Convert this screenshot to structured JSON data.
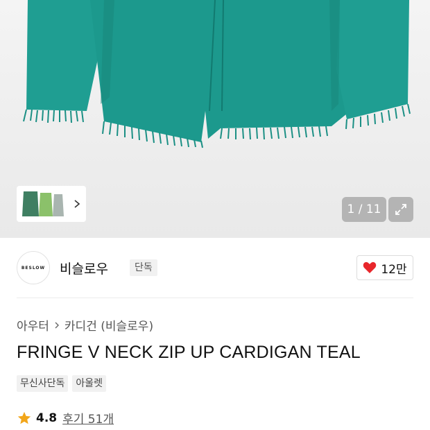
{
  "gallery": {
    "counter_text": "1 / 11",
    "colors": {
      "teal": "#1f9e92",
      "teal_dark": "#17857a"
    },
    "thumbnails": [
      "green-cardigan-icon",
      "lime-cardigan-icon",
      "grey-cardigan-icon"
    ]
  },
  "brand": {
    "logo_text": "BESLOW",
    "name": "비슬로우",
    "badge": "단독"
  },
  "like": {
    "count": "12만",
    "color": "#e8262b"
  },
  "breadcrumb": {
    "category": "아우터",
    "subcategory": "카디건 (비슬로우)"
  },
  "product": {
    "title": "FRINGE V NECK ZIP UP CARDIGAN TEAL",
    "tags": [
      "무신사단독",
      "아울렛"
    ]
  },
  "rating": {
    "score": "4.8",
    "reviews_label": "후기 51개",
    "star_color": "#f2a61a"
  }
}
